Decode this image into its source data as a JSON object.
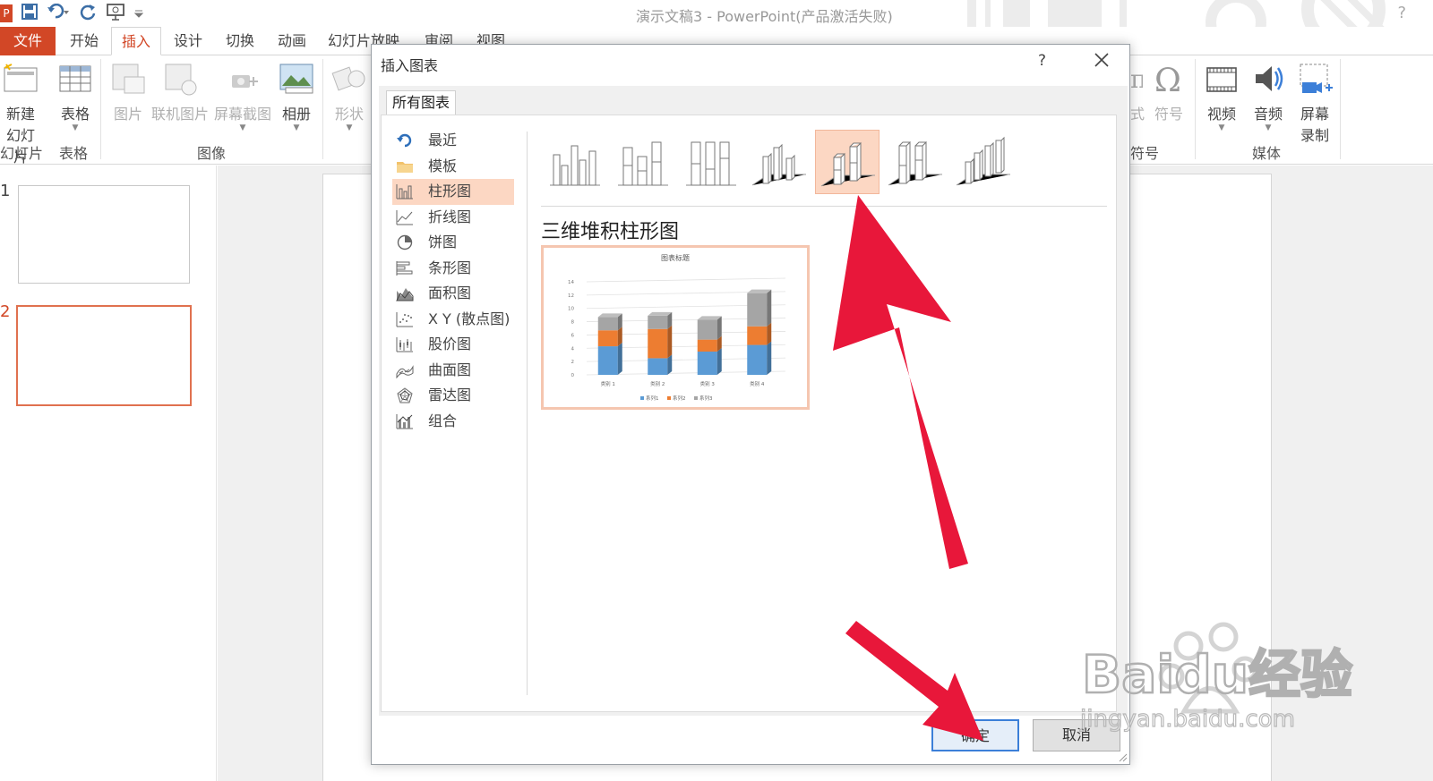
{
  "app": {
    "window_title": "演示文稿3 - PowerPoint(产品激活失败)",
    "title_help": "?"
  },
  "ribbon_tabs": [
    {
      "label": "文件"
    },
    {
      "label": "开始"
    },
    {
      "label": "插入"
    },
    {
      "label": "设计"
    },
    {
      "label": "切换"
    },
    {
      "label": "动画"
    },
    {
      "label": "幻灯片放映"
    },
    {
      "label": "审阅"
    },
    {
      "label": "视图"
    }
  ],
  "active_tab": "插入",
  "ribbon": {
    "new_slide": {
      "line1": "新建",
      "line2": "幻灯片"
    },
    "table": "表格",
    "picture": "图片",
    "online_picture": "联机图片",
    "screenshot": "屏幕截图",
    "album": "相册",
    "shapes": "形状",
    "formula_partial": "式",
    "symbol": "符号",
    "video": "视频",
    "audio": "音频",
    "screen_record": {
      "line1": "屏幕",
      "line2": "录制"
    },
    "groups": {
      "slides": "幻灯片",
      "tables": "表格",
      "images": "图像",
      "symbols": "符号",
      "media": "媒体"
    }
  },
  "slides": [
    {
      "number": "1"
    },
    {
      "number": "2"
    }
  ],
  "dialog": {
    "title": "插入图表",
    "help": "?",
    "tab": "所有图表",
    "categories": [
      {
        "label": "最近",
        "icon": "recent-icon"
      },
      {
        "label": "模板",
        "icon": "folder-icon"
      },
      {
        "label": "柱形图",
        "icon": "column-chart-icon"
      },
      {
        "label": "折线图",
        "icon": "line-chart-icon"
      },
      {
        "label": "饼图",
        "icon": "pie-chart-icon"
      },
      {
        "label": "条形图",
        "icon": "bar-chart-icon"
      },
      {
        "label": "面积图",
        "icon": "area-chart-icon"
      },
      {
        "label": "X Y (散点图)",
        "icon": "scatter-chart-icon"
      },
      {
        "label": "股价图",
        "icon": "stock-chart-icon"
      },
      {
        "label": "曲面图",
        "icon": "surface-chart-icon"
      },
      {
        "label": "雷达图",
        "icon": "radar-chart-icon"
      },
      {
        "label": "组合",
        "icon": "combo-chart-icon"
      }
    ],
    "selected_category": "柱形图",
    "subtype_count": 7,
    "selected_subtype_index": 4,
    "selected_subtype_name": "三维堆积柱形图",
    "ok_label": "确定",
    "cancel_label": "取消"
  },
  "chart_data": {
    "type": "bar",
    "stacked": true,
    "three_d": true,
    "title": "图表标题",
    "categories": [
      "类别 1",
      "类别 2",
      "类别 3",
      "类别 4"
    ],
    "series": [
      {
        "name": "系列1",
        "values": [
          4.3,
          2.5,
          3.5,
          4.5
        ],
        "color": "#5b9bd5"
      },
      {
        "name": "系列2",
        "values": [
          2.4,
          4.4,
          1.8,
          2.8
        ],
        "color": "#ed7d31"
      },
      {
        "name": "系列3",
        "values": [
          2,
          2,
          3,
          5
        ],
        "color": "#a5a5a5"
      }
    ],
    "y_ticks": [
      "0",
      "2",
      "4",
      "6",
      "8",
      "10",
      "12",
      "14"
    ],
    "ylim": [
      0,
      14
    ],
    "legend": "bottom",
    "grid": true
  },
  "watermark": {
    "brand": "Baidu经验",
    "url": "jingyan.baidu.com"
  },
  "colors": {
    "accent": "#d24726",
    "selection": "#fcd7c3",
    "arrow": "#e8173a"
  }
}
